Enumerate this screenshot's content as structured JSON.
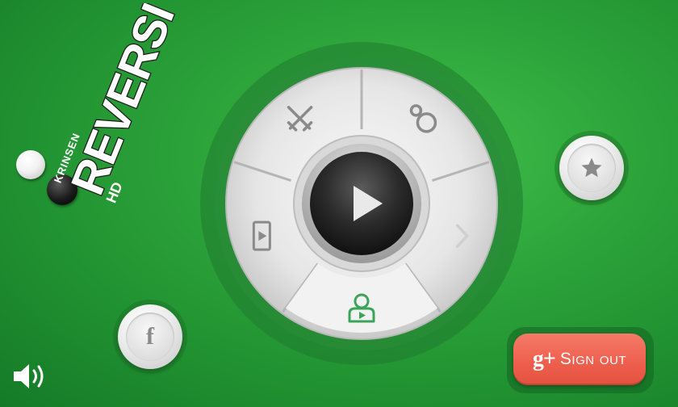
{
  "logo": {
    "brand": "KRINSEN",
    "title": "REVERSI",
    "suffix": "HD"
  },
  "menu": {
    "center": {
      "icon": "play-icon"
    },
    "sectors": [
      {
        "name": "versus",
        "icon": "crossed-swords-icon"
      },
      {
        "name": "multiplayer",
        "icon": "rings-icon"
      },
      {
        "name": "next",
        "icon": "chevron-right-icon"
      },
      {
        "name": "player",
        "icon": "user-play-icon"
      },
      {
        "name": "device",
        "icon": "phone-play-icon"
      }
    ]
  },
  "buttons": {
    "star": {
      "icon": "star-icon"
    },
    "facebook": {
      "icon": "facebook-icon",
      "glyph": "f"
    },
    "sound": {
      "icon": "speaker-icon"
    },
    "signin": {
      "icon": "google-plus-icon",
      "glyph": "g+",
      "label": "Sign out"
    }
  },
  "colors": {
    "background": "#2ea53b",
    "accent_green": "#3aa55a",
    "signin": "#ee5e4c",
    "icon_gray": "#8a8a8a"
  }
}
